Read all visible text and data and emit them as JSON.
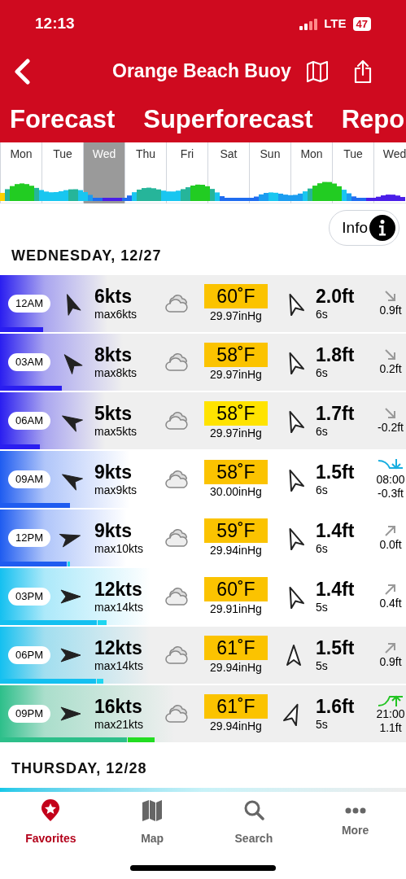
{
  "status_bar": {
    "time": "12:13",
    "network": "LTE",
    "battery": "47"
  },
  "header": {
    "title": "Orange Beach Buoy"
  },
  "tabs": [
    {
      "label": "Forecast"
    },
    {
      "label": "Superforecast"
    },
    {
      "label": "Repo"
    }
  ],
  "day_strip": [
    {
      "label": "Mon",
      "selected": false
    },
    {
      "label": "Tue",
      "selected": false
    },
    {
      "label": "Wed",
      "selected": true
    },
    {
      "label": "Thu",
      "selected": false
    },
    {
      "label": "Fri",
      "selected": false
    },
    {
      "label": "Sat",
      "selected": false
    },
    {
      "label": "Sun",
      "selected": false
    },
    {
      "label": "Mon",
      "selected": false
    },
    {
      "label": "Tue",
      "selected": false
    },
    {
      "label": "Wed",
      "selected": false
    }
  ],
  "info_button": "Info",
  "days": [
    {
      "heading": "WEDNESDAY, 12/27",
      "rows": [
        {
          "time": "12AM",
          "daylight": false,
          "color": "#2a1ef0",
          "wind_arrow": {
            "kind": "nnw"
          },
          "wind": "6kts",
          "max": "max6kts",
          "wind_bar": {
            "level": 0.106
          },
          "temp": "60˚F",
          "temp_box": {
            "color": "#fbc300"
          },
          "pressure": "29.97inHg",
          "swell_arrow": {
            "kind": "nnw"
          },
          "swell": "2.0ft",
          "period": "6s",
          "tide_icon": {
            "kind": "falling"
          },
          "tide": "0.9ft"
        },
        {
          "time": "03AM",
          "daylight": false,
          "color": "#2a1ef0",
          "wind_arrow": {
            "kind": "nw"
          },
          "wind": "8kts",
          "max": "max8kts",
          "wind_bar": {
            "level": 0.153
          },
          "temp": "58˚F",
          "temp_box": {
            "color": "#fbc300"
          },
          "pressure": "29.97inHg",
          "swell_arrow": {
            "kind": "nnw"
          },
          "swell": "1.8ft",
          "period": "6s",
          "tide_icon": {
            "kind": "falling"
          },
          "tide": "0.2ft"
        },
        {
          "time": "06AM",
          "daylight": false,
          "color": "#2a1ef0",
          "wind_arrow": {
            "kind": "wnw"
          },
          "wind": "5kts",
          "max": "max5kts",
          "wind_bar": {
            "level": 0.098
          },
          "temp": "58˚F",
          "temp_box": {
            "color": "#ffe300"
          },
          "pressure": "29.97inHg",
          "swell_arrow": {
            "kind": "nnw"
          },
          "swell": "1.7ft",
          "period": "6s",
          "tide_icon": {
            "kind": "falling"
          },
          "tide": "-0.2ft"
        },
        {
          "time": "09AM",
          "daylight": true,
          "color": "#1f5cf0",
          "wind_arrow": {
            "kind": "wnw"
          },
          "wind": "9kts",
          "max": "max9kts",
          "wind_bar": {
            "level": 0.173
          },
          "temp": "58˚F",
          "temp_box": {
            "color": "#fbc300"
          },
          "pressure": "30.00inHg",
          "swell_arrow": {
            "kind": "nnw"
          },
          "swell": "1.5ft",
          "period": "6s",
          "tide_icon": {
            "kind": "low"
          },
          "tide_time": "08:00",
          "tide": "-0.3ft"
        },
        {
          "time": "12PM",
          "daylight": true,
          "color": "#1f5cf0",
          "wind_arrow": {
            "kind": "ene"
          },
          "wind": "9kts",
          "max": "max10kts",
          "wind_bar": {
            "level": 0.164
          },
          "gust_bar": {
            "level": 0.17
          },
          "temp": "59˚F",
          "temp_box": {
            "color": "#fbc300"
          },
          "pressure": "29.94inHg",
          "swell_arrow": {
            "kind": "nnw"
          },
          "swell": "1.4ft",
          "period": "6s",
          "tide_icon": {
            "kind": "rising"
          },
          "tide": "0.0ft"
        },
        {
          "time": "03PM",
          "daylight": true,
          "color": "#14c0f0",
          "wind_arrow": {
            "kind": "e"
          },
          "wind": "12kts",
          "max": "max14kts",
          "wind_bar": {
            "level": 0.238
          },
          "gust_bar": {
            "level": 0.26
          },
          "temp": "60˚F",
          "temp_box": {
            "color": "#fbc300"
          },
          "pressure": "29.91inHg",
          "swell_arrow": {
            "kind": "nnw"
          },
          "swell": "1.4ft",
          "period": "5s",
          "tide_icon": {
            "kind": "rising"
          },
          "tide": "0.4ft"
        },
        {
          "time": "06PM",
          "daylight": false,
          "color": "#14c0f0",
          "wind_arrow": {
            "kind": "e"
          },
          "wind": "12kts",
          "max": "max14kts",
          "wind_bar": {
            "level": 0.237
          },
          "gust_bar": {
            "level": 0.252
          },
          "temp": "61˚F",
          "temp_box": {
            "color": "#fbc300"
          },
          "pressure": "29.94inHg",
          "swell_arrow": {
            "kind": "n"
          },
          "swell": "1.5ft",
          "period": "5s",
          "tide_icon": {
            "kind": "rising"
          },
          "tide": "0.9ft"
        },
        {
          "time": "09PM",
          "daylight": false,
          "color": "#2dbf8a",
          "wind_arrow": {
            "kind": "e"
          },
          "wind": "16kts",
          "max": "max21kts",
          "wind_bar": {
            "level": 0.312
          },
          "gust_bar": {
            "level": 0.379
          },
          "temp": "61˚F",
          "temp_box": {
            "color": "#fbc300"
          },
          "pressure": "29.94inHg",
          "swell_arrow": {
            "kind": "nne"
          },
          "swell": "1.6ft",
          "period": "5s",
          "tide_icon": {
            "kind": "high"
          },
          "tide_time": "21:00",
          "tide": "1.1ft"
        }
      ]
    },
    {
      "heading": "THURSDAY, 12/28"
    }
  ],
  "bottom_nav": [
    {
      "label": "Favorites",
      "selected": true,
      "kind": "favorites"
    },
    {
      "label": "Map",
      "selected": false,
      "kind": "map"
    },
    {
      "label": "Search",
      "selected": false,
      "kind": "search"
    },
    {
      "label": "More",
      "selected": false,
      "kind": "more"
    }
  ]
}
